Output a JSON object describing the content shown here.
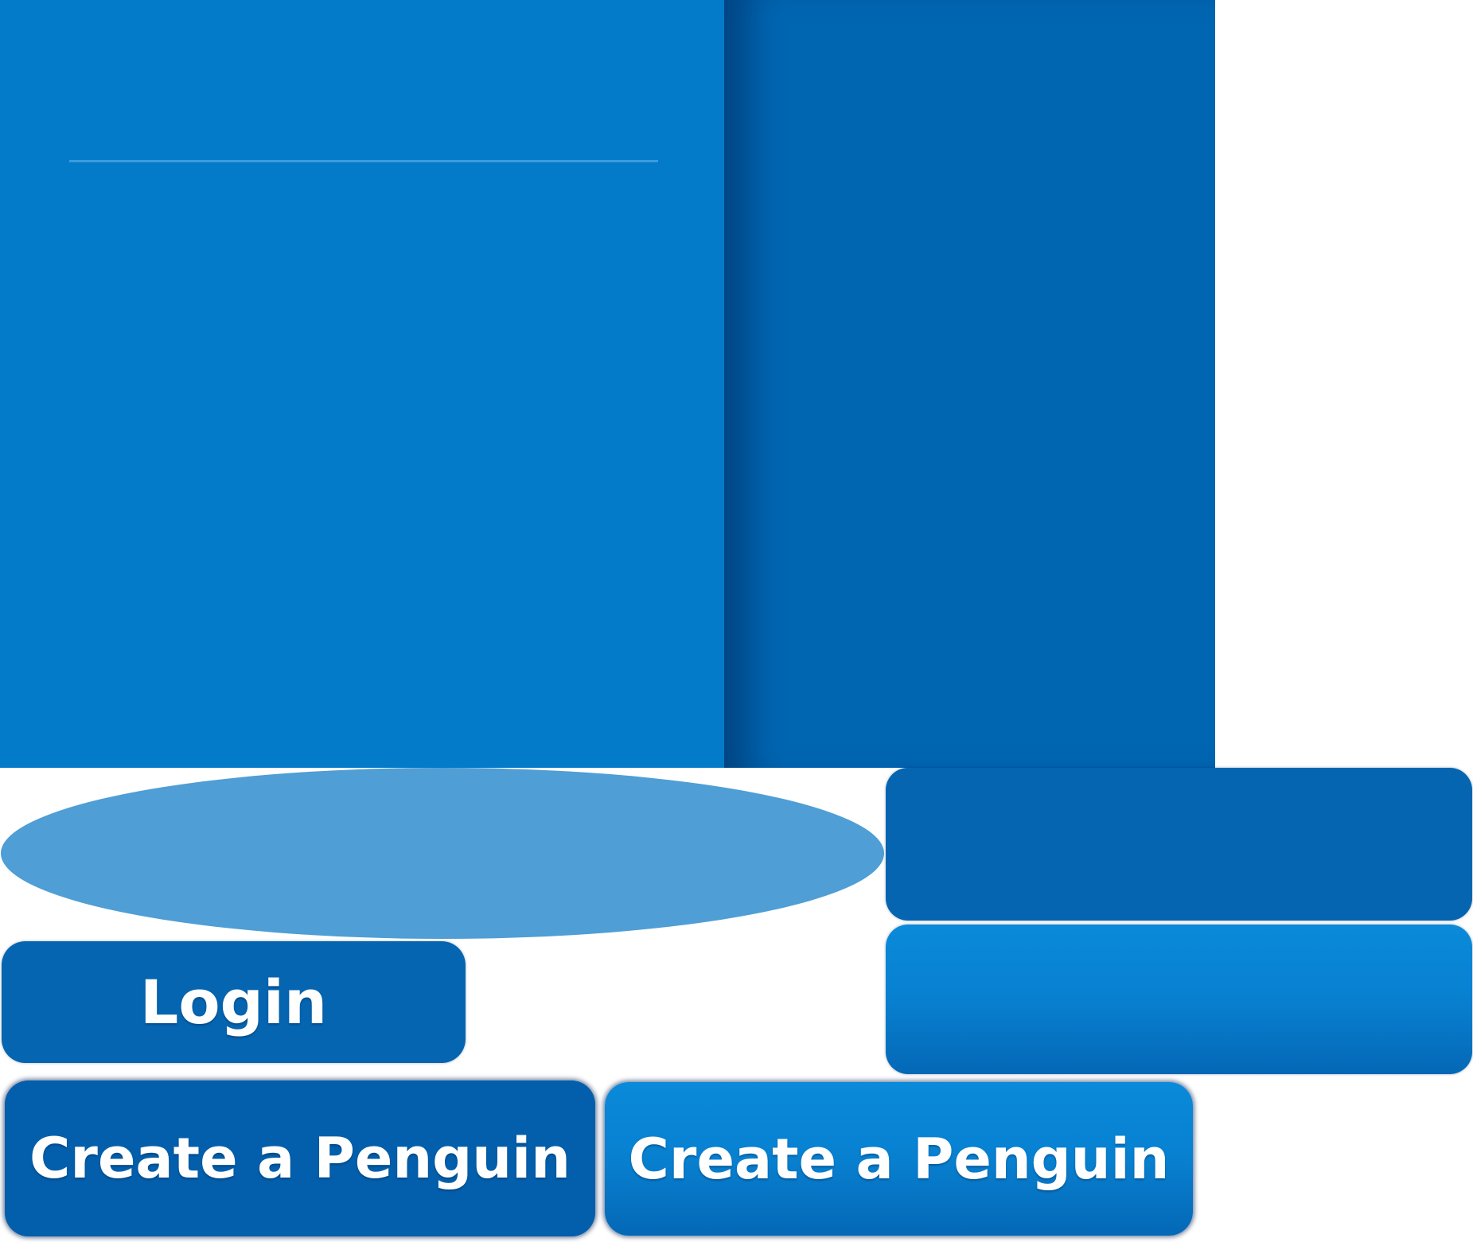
{
  "buttons": {
    "login_label": "Login",
    "create_penguin_label": "Create a Penguin",
    "create_penguin_hover_label": "Create a Penguin"
  },
  "colors": {
    "panel_blue": "#037bc9",
    "side_panel_blue": "#0066b2",
    "button_dark": "#035fab",
    "button_light": "#0a8ada",
    "highlight": "#4f9ed5",
    "text": "#ffffff"
  }
}
